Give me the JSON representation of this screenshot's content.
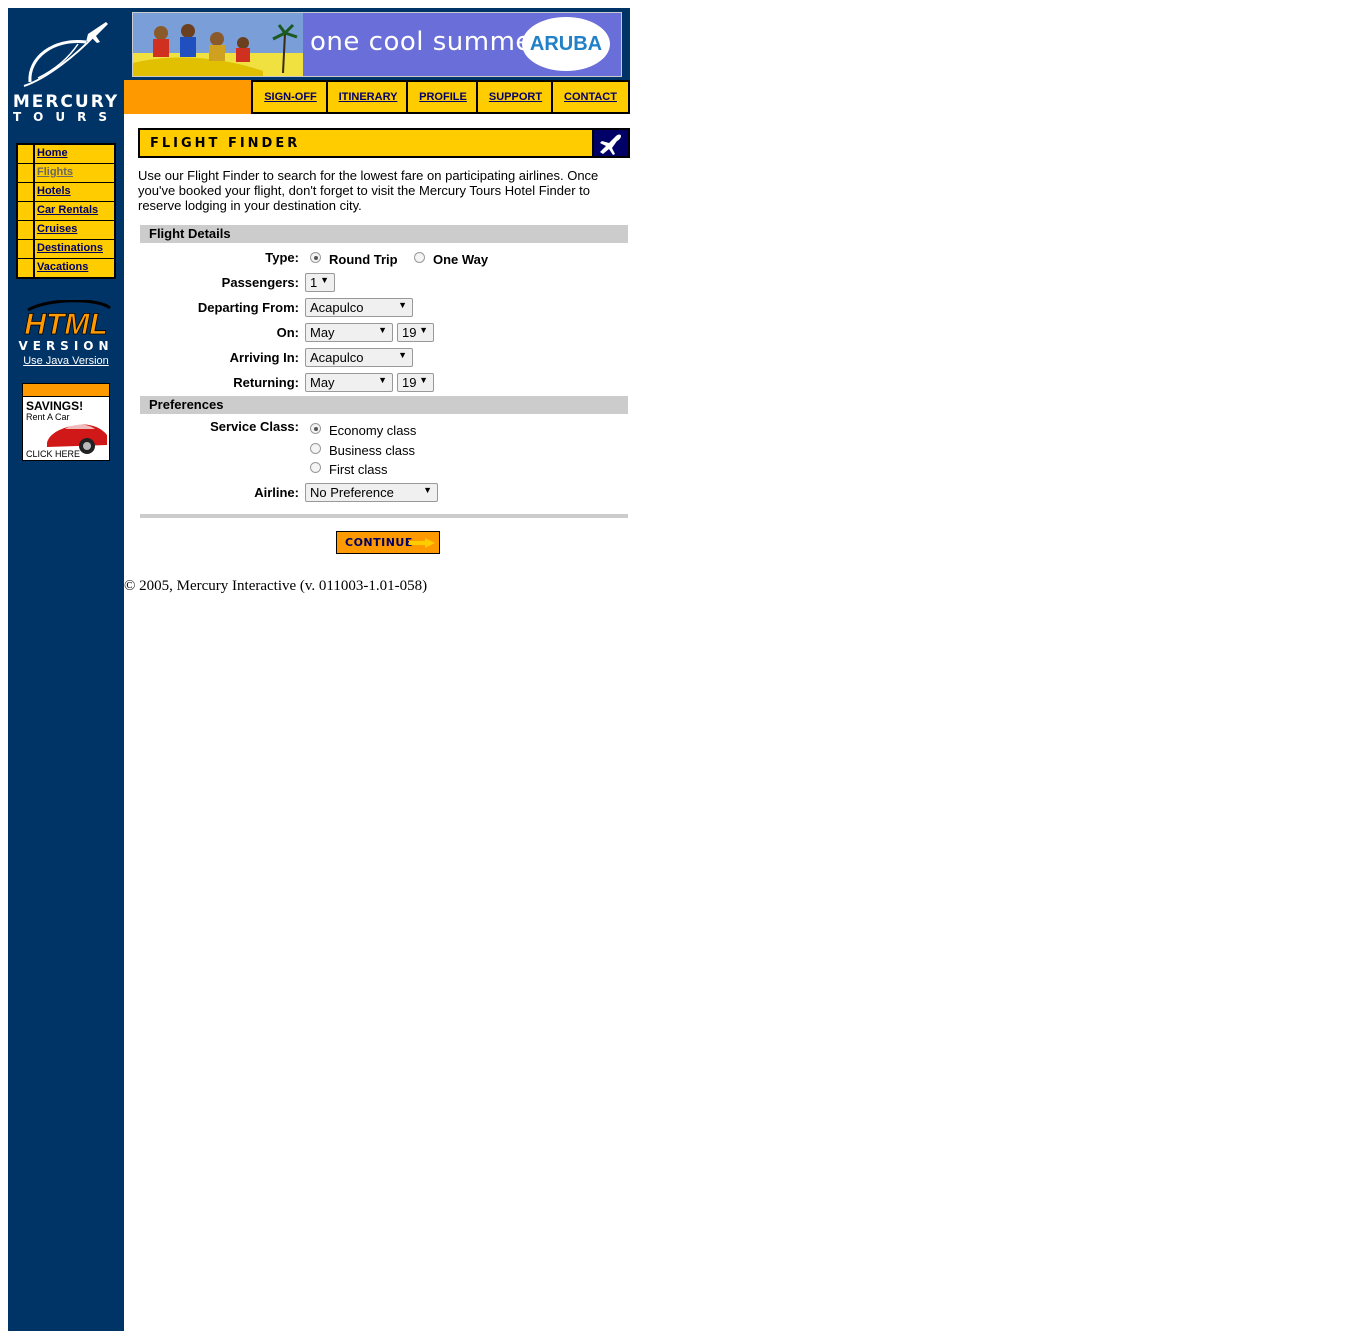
{
  "sidebar": {
    "logo_line1": "MERCURY",
    "logo_line2": "TOURS",
    "nav": [
      {
        "label": "Home"
      },
      {
        "label": "Flights"
      },
      {
        "label": "Hotels"
      },
      {
        "label": "Car Rentals"
      },
      {
        "label": "Cruises"
      },
      {
        "label": "Destinations"
      },
      {
        "label": "Vacations"
      }
    ],
    "html_version_line1": "HTML",
    "html_version_line2": "VERSION",
    "java_link": "Use Java Version",
    "ad": {
      "headline": "SAVINGS!",
      "sub": "Rent A Car",
      "cta": "CLICK HERE"
    }
  },
  "banner": {
    "slogan": "one cool summer",
    "brand": "ARUBA"
  },
  "topnav": [
    {
      "label": "SIGN-OFF"
    },
    {
      "label": "ITINERARY"
    },
    {
      "label": "PROFILE"
    },
    {
      "label": "SUPPORT"
    },
    {
      "label": "CONTACT"
    }
  ],
  "main": {
    "header_title": "FLIGHT FINDER",
    "intro": "Use our Flight Finder to search for the lowest fare on participating airlines. Once you've booked your flight, don't forget to visit the Mercury Tours Hotel Finder to reserve lodging in your destination city.",
    "flight_details": {
      "section_title": "Flight Details",
      "type_label": "Type:",
      "type_options": [
        "Round Trip",
        "One Way"
      ],
      "type_selected": "Round Trip",
      "passengers_label": "Passengers:",
      "passengers_value": "1",
      "departing_label": "Departing From:",
      "departing_value": "Acapulco",
      "on_label": "On:",
      "on_month": "May",
      "on_day": "19",
      "arriving_label": "Arriving In:",
      "arriving_value": "Acapulco",
      "returning_label": "Returning:",
      "returning_month": "May",
      "returning_day": "19"
    },
    "preferences": {
      "section_title": "Preferences",
      "service_label": "Service Class:",
      "service_options": [
        "Economy class",
        "Business class",
        "First class"
      ],
      "service_selected": "Economy class",
      "airline_label": "Airline:",
      "airline_value": "No Preference"
    },
    "continue_label": "CONTINUE"
  },
  "footer": "© 2005, Mercury Interactive (v. 011003-1.01-058)",
  "colors": {
    "navy": "#003366",
    "orange": "#FF9900",
    "yellow": "#FFCC00",
    "link": "#000066",
    "gray": "#CCCCCC"
  }
}
